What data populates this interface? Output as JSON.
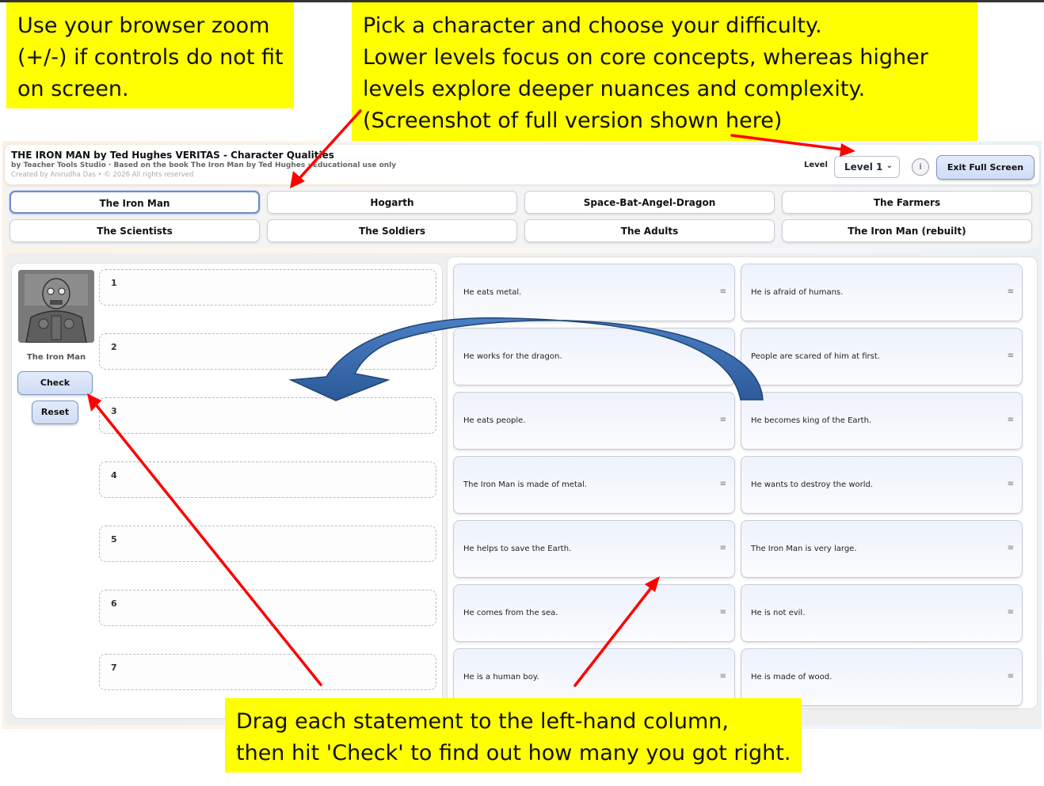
{
  "notes": {
    "zoom": [
      "Use your browser zoom",
      "(+/-) if controls do not fit",
      "on screen."
    ],
    "pick": [
      "Pick a character and choose your difficulty.",
      "Lower levels focus on core concepts, whereas higher",
      "levels explore deeper nuances and complexity.",
      "(Screenshot of full version shown here)"
    ],
    "drag": [
      "Drag each statement to the left-hand column,",
      "then hit 'Check' to find out how many you got right."
    ]
  },
  "header": {
    "title": "THE IRON MAN by Ted Hughes VERITAS - Character Qualities",
    "subtitle": "by Teacher Tools Studio · Based on the book The Iron Man by Ted Hughes · Educational use only",
    "credit": "Created by Anirudha Das • © 2026 All rights reserved",
    "level_label": "Level",
    "level_value": "Level 1",
    "info_label": "i",
    "exit_label": "Exit Full Screen"
  },
  "characters": [
    "The Iron Man",
    "Hogarth",
    "Space-Bat-Angel-Dragon",
    "The Farmers",
    "The Scientists",
    "The Soldiers",
    "The Adults",
    "The Iron Man (rebuilt)"
  ],
  "selected_character": "The Iron Man",
  "left": {
    "name": "The Iron Man",
    "check_label": "Check",
    "reset_label": "Reset",
    "slots": [
      "1",
      "2",
      "3",
      "4",
      "5",
      "6",
      "7"
    ]
  },
  "statements": {
    "grip_icon": "≡",
    "left": [
      "He eats metal.",
      "He works for the dragon.",
      "He eats people.",
      "The Iron Man is made of metal.",
      "He helps to save the Earth.",
      "He comes from the sea.",
      "He is a human boy."
    ],
    "right": [
      "He is afraid of humans.",
      "People are scared of him at first.",
      "He becomes king of the Earth.",
      "He wants to destroy the world.",
      "The Iron Man is very large.",
      "He is not evil.",
      "He is made of wood."
    ]
  },
  "colors": {
    "callout": "#ffff00",
    "arrow_red": "#ff0000",
    "curved_arrow": "#3e6fb0",
    "button_blue": "#cfdcf5"
  }
}
